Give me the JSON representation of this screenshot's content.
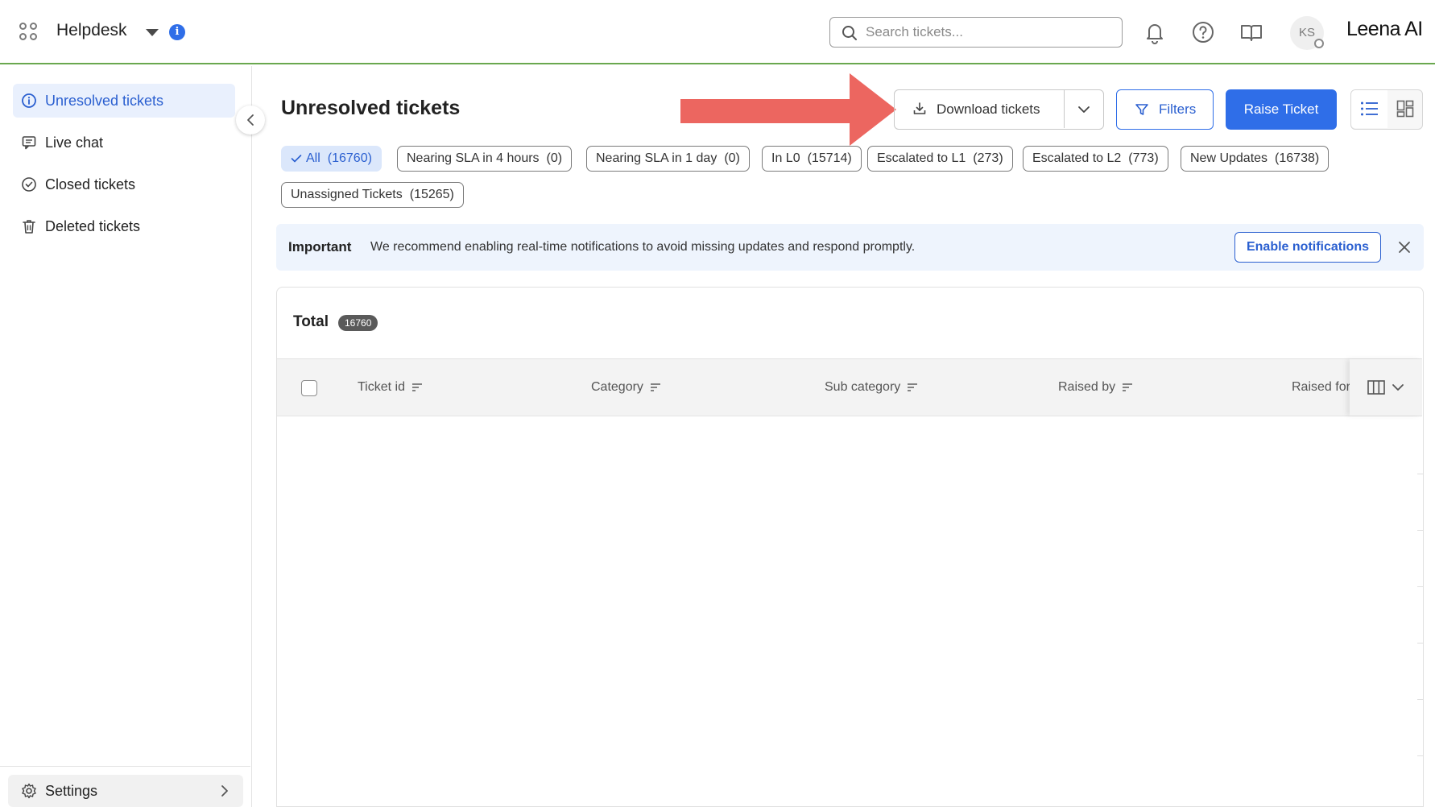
{
  "topbar": {
    "app_name": "Helpdesk",
    "search_placeholder": "Search tickets...",
    "avatar_initials": "KS",
    "logo_text": "Leena AI"
  },
  "sidebar": {
    "items": [
      {
        "label": "Unresolved tickets",
        "icon": "info-circle-icon",
        "active": true
      },
      {
        "label": "Live chat",
        "icon": "chat-icon",
        "active": false
      },
      {
        "label": "Closed tickets",
        "icon": "check-circle-icon",
        "active": false
      },
      {
        "label": "Deleted tickets",
        "icon": "trash-icon",
        "active": false
      }
    ],
    "settings_label": "Settings"
  },
  "main": {
    "title": "Unresolved tickets",
    "download_label": "Download tickets",
    "filters_label": "Filters",
    "raise_label": "Raise Ticket",
    "chips": [
      {
        "label": "All",
        "count": "(16760)",
        "active": true
      },
      {
        "label": "Nearing SLA in 4 hours",
        "count": "(0)",
        "active": false
      },
      {
        "label": "Nearing SLA in 1 day",
        "count": "(0)",
        "active": false
      },
      {
        "label": "In L0",
        "count": "(15714)",
        "active": false
      },
      {
        "label": "Escalated to L1",
        "count": "(273)",
        "active": false
      },
      {
        "label": "Escalated to L2",
        "count": "(773)",
        "active": false
      },
      {
        "label": "New Updates",
        "count": "(16738)",
        "active": false
      },
      {
        "label": "Unassigned Tickets",
        "count": "(15265)",
        "active": false
      }
    ],
    "banner": {
      "title": "Important",
      "text": "We recommend enabling real-time notifications to avoid missing updates and respond promptly.",
      "button": "Enable notifications"
    },
    "table": {
      "total_label": "Total",
      "total_count": "16760",
      "columns": [
        "Ticket id",
        "Category",
        "Sub category",
        "Raised by",
        "Raised for"
      ]
    }
  },
  "colors": {
    "accent": "#2f6ee8",
    "arrow": "#ec6660",
    "topbar_border": "#6aa84f"
  }
}
